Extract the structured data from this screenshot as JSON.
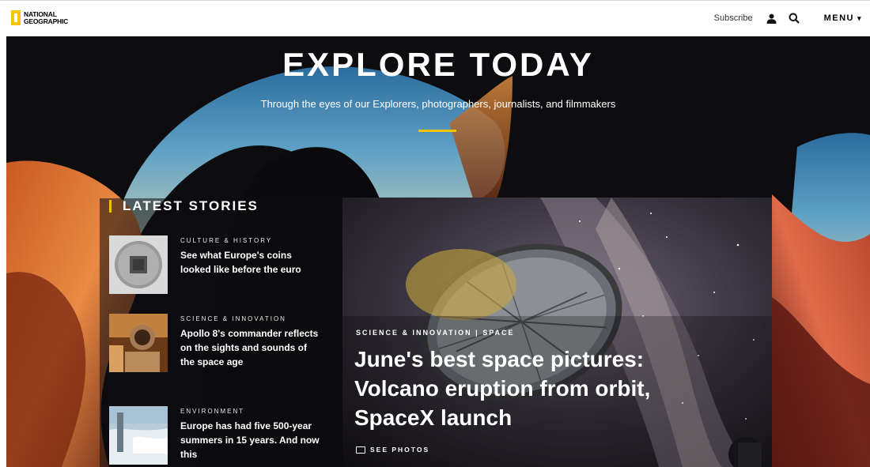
{
  "header": {
    "logo_line1": "NATIONAL",
    "logo_line2": "GEOGRAPHIC",
    "subscribe_label": "Subscribe",
    "user_icon": "user-icon",
    "search_icon": "search-icon",
    "menu_label": "MENU",
    "menu_caret": "▾"
  },
  "hero": {
    "title": "EXPLORE TODAY",
    "subtitle": "Through the eyes of our Explorers, photographers, journalists, and filmmakers",
    "accent_color": "#f2c300"
  },
  "latest": {
    "heading": "LATEST STORIES",
    "stories": [
      {
        "category": "CULTURE & HISTORY",
        "headline": "See what Europe's coins looked like before the euro"
      },
      {
        "category": "SCIENCE & INNOVATION",
        "headline": "Apollo 8's commander reflects on the sights and sounds of the space age"
      },
      {
        "category": "ENVIRONMENT",
        "headline": "Europe has had five 500-year summers in 15 years. And now this"
      }
    ]
  },
  "feature": {
    "category": "SCIENCE & INNOVATION  |  SPACE",
    "headline": "June's best space pictures: Volcano eruption from orbit, SpaceX launch",
    "cta": "SEE PHOTOS"
  }
}
